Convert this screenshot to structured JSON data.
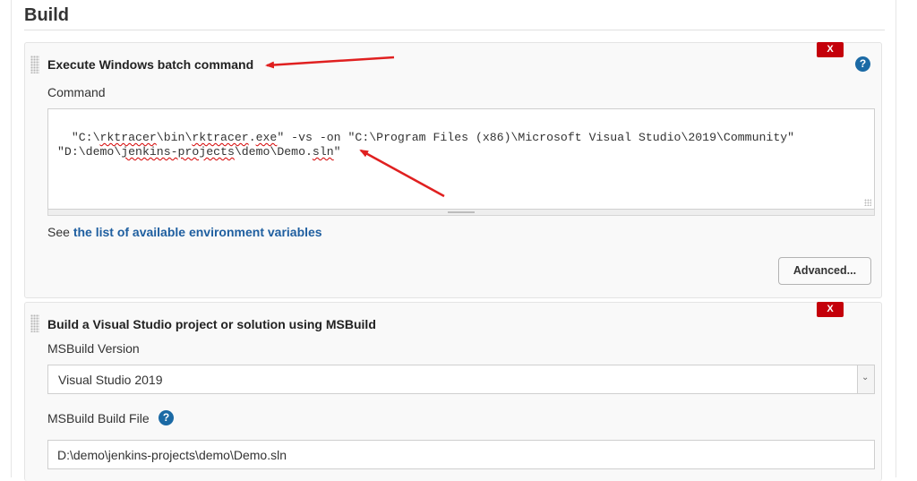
{
  "build": {
    "section_title": "Build"
  },
  "batch_step": {
    "title": "Execute Windows batch command",
    "delete_label": "X",
    "help_label": "?",
    "command_label": "Command",
    "command_segments": [
      {
        "text": "\"C:\\",
        "spell": false
      },
      {
        "text": "rktracer",
        "spell": true
      },
      {
        "text": "\\bin\\",
        "spell": false
      },
      {
        "text": "rktracer",
        "spell": true
      },
      {
        "text": ".",
        "spell": false
      },
      {
        "text": "exe",
        "spell": true
      },
      {
        "text": "\" -vs -on \"C:\\Program Files (x86)\\Microsoft Visual Studio\\2019\\Community\"\n\"D:\\demo\\",
        "spell": false
      },
      {
        "text": "jenkins-projects",
        "spell": true
      },
      {
        "text": "\\demo\\Demo.",
        "spell": false
      },
      {
        "text": "sln",
        "spell": true
      },
      {
        "text": "\"",
        "spell": false
      }
    ],
    "env_prefix": "See",
    "env_link": "the list of available environment variables",
    "advanced_label": "Advanced..."
  },
  "msbuild_step": {
    "title": "Build a Visual Studio project or solution using MSBuild",
    "delete_label": "X",
    "version_label": "MSBuild Version",
    "version_value": "Visual Studio 2019",
    "build_file_label": "MSBuild Build File",
    "build_file_help": "?",
    "build_file_value": "D:\\demo\\jenkins-projects\\demo\\Demo.sln"
  },
  "colors": {
    "delete": "#c4000a",
    "help": "#1b6aa5",
    "link": "#1f5fa0",
    "annotation_arrow": "#e02020"
  },
  "icons": {
    "drag_handle": "drag-handle-icon",
    "help": "help-icon",
    "select_arrow": "chevron-down-icon"
  }
}
